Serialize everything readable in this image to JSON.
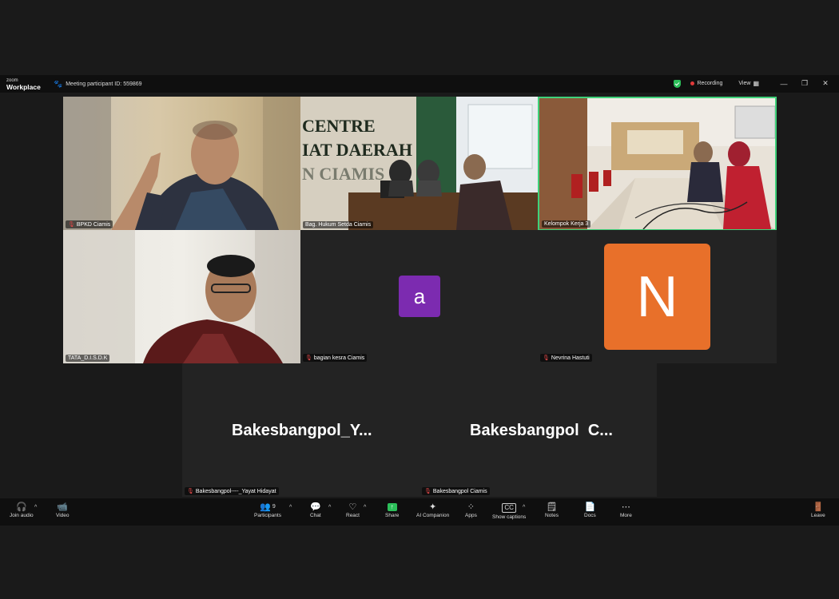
{
  "app": {
    "logo_small": "zoom",
    "logo_big": "Workplace",
    "meeting_id": "Meeting participant ID: 559869",
    "recording": "Recording",
    "view": "View"
  },
  "colors": {
    "active_speaker": "#3fd17a",
    "avatar_a": "#7c2bb0",
    "avatar_n": "#e8702a",
    "share": "#2cbf5a"
  },
  "tiles": {
    "t1": {
      "name": "BPKD Ciamis"
    },
    "t2": {
      "name": "Bag. Hukum Setda Ciamis",
      "wall_line1": "CENTRE",
      "wall_line2": "IAT DAERAH",
      "wall_line3": "N CIAMIS"
    },
    "t3": {
      "name": "Kelompok Kerja 3"
    },
    "t4": {
      "name": "TATA_D.I.S.D.K"
    },
    "t5": {
      "name": "bagian kesra Ciamis",
      "initial": "a"
    },
    "t6": {
      "name": "Nevrina Hastuti",
      "initial": "N"
    },
    "t7": {
      "name": "Bakesbangpol----_Yayat Hidayat",
      "display": "Bakesbangpol_Y..."
    },
    "t8": {
      "name": "Bakesbangpol Ciamis",
      "display": "Bakesbangpol  C..."
    }
  },
  "toolbar": {
    "join_audio": "Join audio",
    "video": "Video",
    "participants": "Participants",
    "participants_count": "9",
    "chat": "Chat",
    "react": "React",
    "share": "Share",
    "ai_companion": "AI Companion",
    "apps": "Apps",
    "show_captions": "Show captions",
    "notes": "Notes",
    "docs": "Docs",
    "more": "More",
    "leave": "Leave"
  }
}
